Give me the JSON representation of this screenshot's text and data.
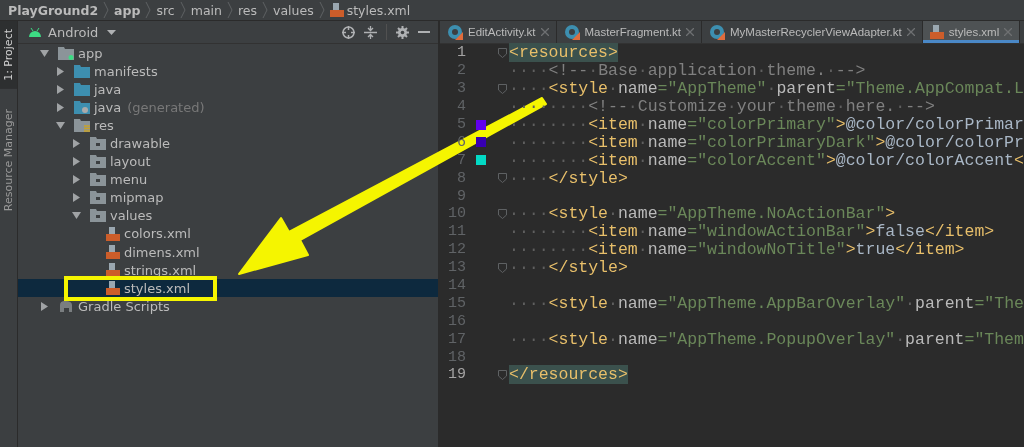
{
  "breadcrumb": [
    {
      "label": "PlayGround2",
      "bold": true
    },
    {
      "label": "app",
      "bold": true
    },
    {
      "label": "src",
      "bold": false
    },
    {
      "label": "main",
      "bold": false
    },
    {
      "label": "res",
      "bold": false
    },
    {
      "label": "values",
      "bold": false
    },
    {
      "label": "styles.xml",
      "bold": false,
      "kind": "xml"
    }
  ],
  "tool_strip": [
    {
      "label": "1: Project",
      "selected": true
    },
    {
      "label": "Resource Manager",
      "selected": false
    }
  ],
  "project_panel": {
    "view": "Android",
    "tree": [
      {
        "label": "app",
        "kind": "module",
        "expanded": true,
        "selected": false,
        "children": [
          {
            "label": "manifests",
            "kind": "folder",
            "expanded": false,
            "selected": false
          },
          {
            "label": "java",
            "kind": "folder",
            "expanded": false,
            "selected": false
          },
          {
            "label": "java",
            "note": "(generated)",
            "kind": "generated",
            "expanded": false,
            "selected": false
          },
          {
            "label": "res",
            "kind": "res",
            "expanded": true,
            "selected": false,
            "children": [
              {
                "label": "drawable",
                "kind": "resfolder",
                "expanded": false,
                "selected": false
              },
              {
                "label": "layout",
                "kind": "resfolder",
                "expanded": false,
                "selected": false
              },
              {
                "label": "menu",
                "kind": "resfolder",
                "expanded": false,
                "selected": false
              },
              {
                "label": "mipmap",
                "kind": "resfolder",
                "expanded": false,
                "selected": false
              },
              {
                "label": "values",
                "kind": "resfolder",
                "expanded": true,
                "selected": false,
                "children": [
                  {
                    "label": "colors.xml",
                    "kind": "xml",
                    "selected": false
                  },
                  {
                    "label": "dimens.xml",
                    "kind": "xml",
                    "selected": false
                  },
                  {
                    "label": "strings.xml",
                    "kind": "xml",
                    "selected": false
                  },
                  {
                    "label": "styles.xml",
                    "kind": "xml",
                    "selected": true
                  }
                ]
              }
            ]
          }
        ]
      },
      {
        "label": "Gradle Scripts",
        "kind": "gradle",
        "expanded": false,
        "selected": false
      }
    ]
  },
  "tabs": [
    {
      "label": "EditActivity.kt",
      "kind": "kotlin",
      "selected": false
    },
    {
      "label": "MasterFragment.kt",
      "kind": "kotlin",
      "selected": false
    },
    {
      "label": "MyMasterRecyclerViewAdapter.kt",
      "kind": "kotlin",
      "selected": false
    },
    {
      "label": "styles.xml",
      "kind": "xml",
      "selected": true
    }
  ],
  "editor": {
    "lines": [
      {
        "number": "1",
        "highlighted": true,
        "fold": true,
        "tokens": [
          {
            "kind": "tag",
            "text": "<resources>"
          }
        ]
      },
      {
        "number": "2",
        "highlighted": false,
        "fold": false,
        "tokens": [
          {
            "kind": "ws",
            "text": "····"
          },
          {
            "kind": "cmt",
            "text": "<!--"
          },
          {
            "kind": "ws",
            "text": "·"
          },
          {
            "kind": "cmt",
            "text": "Base"
          },
          {
            "kind": "ws",
            "text": "·"
          },
          {
            "kind": "cmt",
            "text": "application"
          },
          {
            "kind": "ws",
            "text": "·"
          },
          {
            "kind": "cmt",
            "text": "theme."
          },
          {
            "kind": "ws",
            "text": "·"
          },
          {
            "kind": "cmt",
            "text": "-->"
          }
        ]
      },
      {
        "number": "3",
        "highlighted": false,
        "fold": true,
        "tokens": [
          {
            "kind": "ws",
            "text": "····"
          },
          {
            "kind": "tag",
            "text": "<style"
          },
          {
            "kind": "ws",
            "text": "·"
          },
          {
            "kind": "attr",
            "text": "name"
          },
          {
            "kind": "str",
            "text": "=\"AppTheme\""
          },
          {
            "kind": "ws",
            "text": "·"
          },
          {
            "kind": "attr",
            "text": "parent"
          },
          {
            "kind": "str",
            "text": "=\"Theme.AppCompat.L"
          }
        ]
      },
      {
        "number": "4",
        "highlighted": false,
        "fold": false,
        "tokens": [
          {
            "kind": "ws",
            "text": "········"
          },
          {
            "kind": "cmt",
            "text": "<!--"
          },
          {
            "kind": "ws",
            "text": "·"
          },
          {
            "kind": "cmt",
            "text": "Customize"
          },
          {
            "kind": "ws",
            "text": "·"
          },
          {
            "kind": "cmt",
            "text": "your"
          },
          {
            "kind": "ws",
            "text": "·"
          },
          {
            "kind": "cmt",
            "text": "theme"
          },
          {
            "kind": "ws",
            "text": "·"
          },
          {
            "kind": "cmt",
            "text": "here."
          },
          {
            "kind": "ws",
            "text": "·"
          },
          {
            "kind": "cmt",
            "text": "-->"
          }
        ]
      },
      {
        "number": "5",
        "highlighted": false,
        "fold": false,
        "color": "#6200ee",
        "tokens": [
          {
            "kind": "ws",
            "text": "········"
          },
          {
            "kind": "tag",
            "text": "<item"
          },
          {
            "kind": "ws",
            "text": "·"
          },
          {
            "kind": "attr",
            "text": "name"
          },
          {
            "kind": "str",
            "text": "=\"colorPrimary\""
          },
          {
            "kind": "tag",
            "text": ">"
          },
          {
            "kind": "text",
            "text": "@color/colorPrimar"
          }
        ]
      },
      {
        "number": "6",
        "highlighted": false,
        "fold": false,
        "color": "#3700b3",
        "tokens": [
          {
            "kind": "ws",
            "text": "········"
          },
          {
            "kind": "tag",
            "text": "<item"
          },
          {
            "kind": "ws",
            "text": "·"
          },
          {
            "kind": "attr",
            "text": "name"
          },
          {
            "kind": "str",
            "text": "=\"colorPrimaryDark\""
          },
          {
            "kind": "tag",
            "text": ">"
          },
          {
            "kind": "text",
            "text": "@color/colorPr"
          }
        ]
      },
      {
        "number": "7",
        "highlighted": false,
        "fold": false,
        "color": "#03dac5",
        "tokens": [
          {
            "kind": "ws",
            "text": "········"
          },
          {
            "kind": "tag",
            "text": "<item"
          },
          {
            "kind": "ws",
            "text": "·"
          },
          {
            "kind": "attr",
            "text": "name"
          },
          {
            "kind": "str",
            "text": "=\"colorAccent\""
          },
          {
            "kind": "tag",
            "text": ">"
          },
          {
            "kind": "text",
            "text": "@color/colorAccent"
          },
          {
            "kind": "tag",
            "text": "<"
          }
        ]
      },
      {
        "number": "8",
        "highlighted": false,
        "fold": true,
        "tokens": [
          {
            "kind": "ws",
            "text": "····"
          },
          {
            "kind": "tag",
            "text": "</style>"
          }
        ]
      },
      {
        "number": "9",
        "highlighted": false,
        "fold": false
      },
      {
        "number": "10",
        "highlighted": false,
        "fold": true,
        "tokens": [
          {
            "kind": "ws",
            "text": "····"
          },
          {
            "kind": "tag",
            "text": "<style"
          },
          {
            "kind": "ws",
            "text": "·"
          },
          {
            "kind": "attr",
            "text": "name"
          },
          {
            "kind": "str",
            "text": "=\"AppTheme.NoActionBar\""
          },
          {
            "kind": "tag",
            "text": ">"
          }
        ]
      },
      {
        "number": "11",
        "highlighted": false,
        "fold": false,
        "tokens": [
          {
            "kind": "ws",
            "text": "········"
          },
          {
            "kind": "tag",
            "text": "<item"
          },
          {
            "kind": "ws",
            "text": "·"
          },
          {
            "kind": "attr",
            "text": "name"
          },
          {
            "kind": "str",
            "text": "=\"windowActionBar\""
          },
          {
            "kind": "tag",
            "text": ">"
          },
          {
            "kind": "text",
            "text": "false"
          },
          {
            "kind": "tag",
            "text": "</item>"
          }
        ]
      },
      {
        "number": "12",
        "highlighted": false,
        "fold": false,
        "tokens": [
          {
            "kind": "ws",
            "text": "········"
          },
          {
            "kind": "tag",
            "text": "<item"
          },
          {
            "kind": "ws",
            "text": "·"
          },
          {
            "kind": "attr",
            "text": "name"
          },
          {
            "kind": "str",
            "text": "=\"windowNoTitle\""
          },
          {
            "kind": "tag",
            "text": ">"
          },
          {
            "kind": "text",
            "text": "true"
          },
          {
            "kind": "tag",
            "text": "</item>"
          }
        ]
      },
      {
        "number": "13",
        "highlighted": false,
        "fold": true,
        "tokens": [
          {
            "kind": "ws",
            "text": "····"
          },
          {
            "kind": "tag",
            "text": "</style>"
          }
        ]
      },
      {
        "number": "14",
        "highlighted": false,
        "fold": false
      },
      {
        "number": "15",
        "highlighted": false,
        "fold": false,
        "tokens": [
          {
            "kind": "ws",
            "text": "····"
          },
          {
            "kind": "tag",
            "text": "<style"
          },
          {
            "kind": "ws",
            "text": "·"
          },
          {
            "kind": "attr",
            "text": "name"
          },
          {
            "kind": "str",
            "text": "=\"AppTheme.AppBarOverlay\""
          },
          {
            "kind": "ws",
            "text": "·"
          },
          {
            "kind": "attr",
            "text": "parent"
          },
          {
            "kind": "str",
            "text": "=\"The"
          }
        ]
      },
      {
        "number": "16",
        "highlighted": false,
        "fold": false
      },
      {
        "number": "17",
        "highlighted": false,
        "fold": false,
        "tokens": [
          {
            "kind": "ws",
            "text": "····"
          },
          {
            "kind": "tag",
            "text": "<style"
          },
          {
            "kind": "ws",
            "text": "·"
          },
          {
            "kind": "attr",
            "text": "name"
          },
          {
            "kind": "str",
            "text": "=\"AppTheme.PopupOverlay\""
          },
          {
            "kind": "ws",
            "text": "·"
          },
          {
            "kind": "attr",
            "text": "parent"
          },
          {
            "kind": "str",
            "text": "=\"Them"
          }
        ]
      },
      {
        "number": "18",
        "highlighted": false,
        "fold": false
      },
      {
        "number": "19",
        "highlighted": true,
        "fold": true,
        "tokens": [
          {
            "kind": "tag",
            "text": "</resources>"
          }
        ]
      }
    ]
  },
  "annotation": {
    "kind": "arrow"
  }
}
